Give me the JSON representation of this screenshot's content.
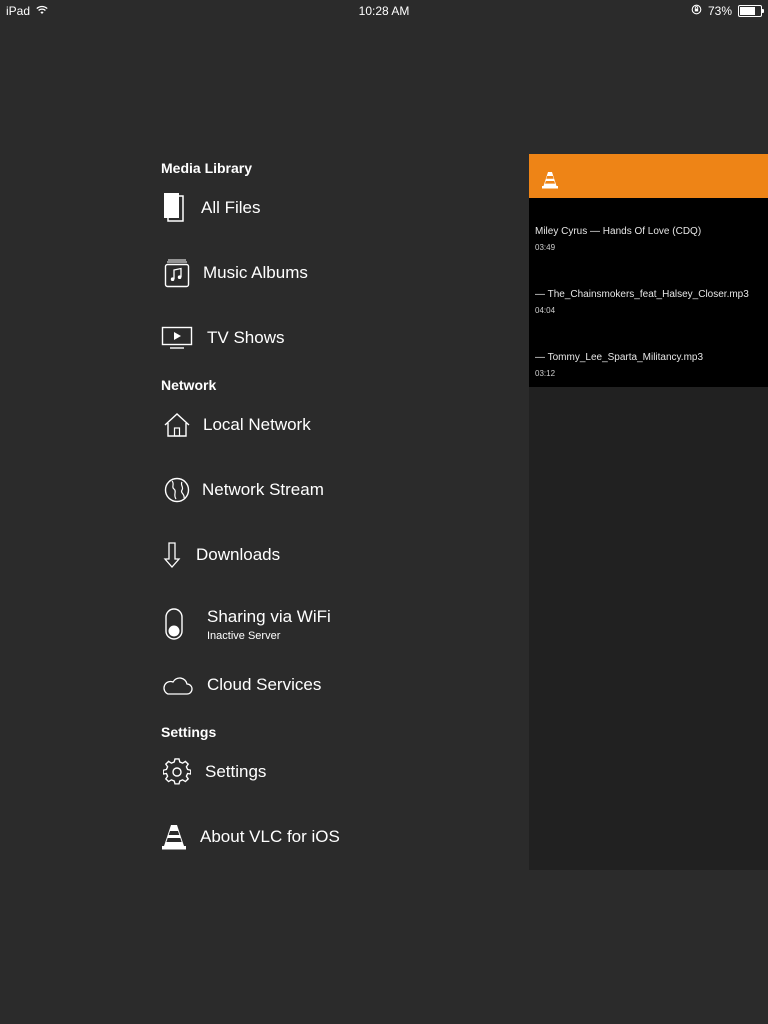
{
  "status_bar": {
    "device": "iPad",
    "time": "10:28 AM",
    "battery_percent": "73%",
    "battery_level": 0.73
  },
  "sections": [
    {
      "header": "Media Library",
      "items": [
        {
          "label": "All Files",
          "icon": "file-icon"
        },
        {
          "label": "Music Albums",
          "icon": "music-album-icon"
        },
        {
          "label": "TV Shows",
          "icon": "tv-icon"
        }
      ]
    },
    {
      "header": "Network",
      "items": [
        {
          "label": "Local Network",
          "icon": "house-icon"
        },
        {
          "label": "Network Stream",
          "icon": "globe-icon"
        },
        {
          "label": "Downloads",
          "icon": "download-arrow-icon"
        },
        {
          "label": "Sharing via WiFi",
          "sublabel": "Inactive Server",
          "icon": "toggle-icon"
        },
        {
          "label": "Cloud Services",
          "icon": "cloud-icon"
        }
      ]
    },
    {
      "header": "Settings",
      "items": [
        {
          "label": "Settings",
          "icon": "gear-icon"
        },
        {
          "label": "About VLC for iOS",
          "icon": "vlc-cone-icon"
        }
      ]
    }
  ],
  "panel": {
    "header_icon": "vlc-cone-icon",
    "accent_color": "#ee8416",
    "tracks": [
      {
        "title": "Miley Cyrus  —  Hands Of Love (CDQ)",
        "duration": "03:49"
      },
      {
        "title": " — The_Chainsmokers_feat_Halsey_Closer.mp3",
        "duration": "04:04"
      },
      {
        "title": " — Tommy_Lee_Sparta_Militancy.mp3",
        "duration": "03:12"
      }
    ]
  }
}
